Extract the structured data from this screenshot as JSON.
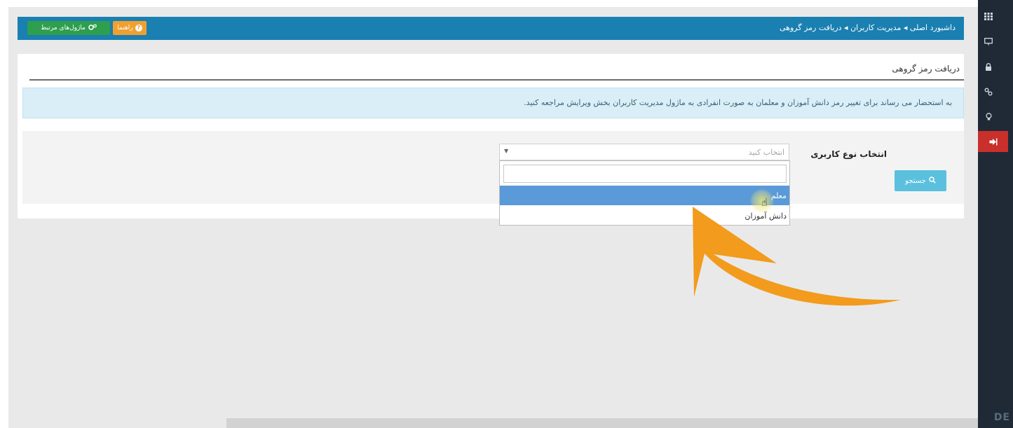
{
  "header": {
    "breadcrumb": "داشبورد اصلی ◂ مدیریت کاربران ◂ دریافت رمز گروهی",
    "help_label": "راهنما",
    "related_label": "ماژول‌های مرتبط"
  },
  "page": {
    "title": "دریافت رمز گروهی",
    "info": "به استحضار می رساند برای تغییر رمز دانش آموزان و معلمان به صورت انفرادی به ماژول مدیریت کاربران بخش ویرایش مراجعه کنید."
  },
  "filter": {
    "user_type_label": "انتخاب نوع کاربری",
    "select_placeholder": "انتخاب کنید",
    "search_button": "جستجو"
  },
  "dropdown": {
    "search_value": "",
    "options": [
      {
        "label": "معلم",
        "highlighted": true
      },
      {
        "label": "دانش آموزان",
        "highlighted": false
      }
    ]
  },
  "sidebar": {
    "icons": [
      "grid-icon",
      "monitor-icon",
      "lock-icon",
      "link-icon",
      "bulb-icon",
      "logout-icon"
    ],
    "active": "logout-icon",
    "footer": "DE"
  },
  "colors": {
    "header": "#1a7fb1",
    "help_button": "#f0a030",
    "related_button": "#2e9e4f",
    "info_background": "#d9eef7",
    "search_button": "#5bc0de",
    "highlight": "#5a9ad9",
    "annotation_arrow": "#f29b1d",
    "sidebar": "#1f2a36",
    "sidebar_active": "#c9302c"
  }
}
